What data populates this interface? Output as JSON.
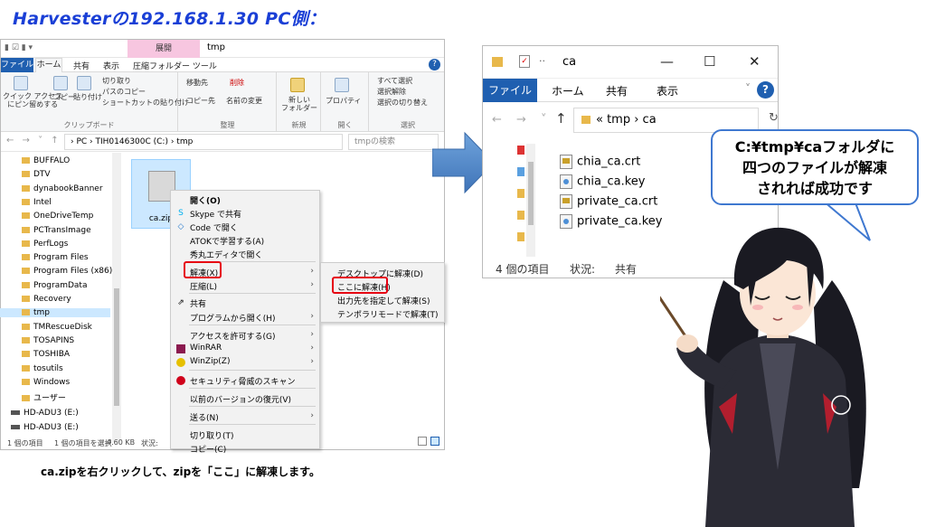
{
  "banner": "Harvesterの192.168.1.30 PC側：",
  "left_window": {
    "title": "tmp",
    "context_tab": "展開",
    "tabs": [
      "ファイル",
      "ホーム",
      "共有",
      "表示",
      "圧縮フォルダー ツール"
    ],
    "ribbon": {
      "pin": "クイック アクセス\nにピン留めする",
      "copy": "コピー",
      "paste": "貼り付け",
      "cut": "切り取り",
      "copy_path": "パスのコピー",
      "paste_shortcut": "ショートカットの貼り付け",
      "clipboard_group": "クリップボード",
      "move_to": "移動先",
      "copy_to": "コピー先",
      "delete": "削除",
      "rename": "名前の変更",
      "organize_group": "整理",
      "new_folder": "新しい\nフォルダー",
      "new_group": "新規",
      "properties": "プロパティ",
      "open_group": "開く",
      "select_all": "すべて選択",
      "select_none": "選択解除",
      "invert_selection": "選択の切り替え",
      "select_group": "選択"
    },
    "address": "›  PC  ›  TIH0146300C (C:)  ›  tmp",
    "search_placeholder": "tmpの検索",
    "tree": [
      "BUFFALO",
      "DTV",
      "dynabookBanner",
      "Intel",
      "OneDriveTemp",
      "PCTransImage",
      "PerfLogs",
      "Program Files",
      "Program Files (x86)",
      "ProgramData",
      "Recovery",
      "tmp",
      "TMRescueDisk",
      "TOSAPINS",
      "TOSHIBA",
      "tosutils",
      "Windows",
      "ユーザー"
    ],
    "drives": [
      "HD-ADU3 (E:)",
      "HD-ADU3 (E:)"
    ],
    "file_name": "ca.zip",
    "status": {
      "count": "1 個の項目",
      "selected": "1 個の項目を選択",
      "size": "4.60 KB",
      "state": "状況:"
    }
  },
  "context_menu": [
    "開く(O)",
    "Skype で共有",
    "Code で開く",
    "ATOKで学習する(A)",
    "秀丸エディタで開く",
    "解凍(X)",
    "圧縮(L)",
    "共有",
    "プログラムから開く(H)",
    "アクセスを許可する(G)",
    "WinRAR",
    "WinZip(Z)",
    "セキュリティ脅威のスキャン",
    "以前のバージョンの復元(V)",
    "送る(N)",
    "切り取り(T)",
    "コピー(C)"
  ],
  "submenu": [
    "デスクトップに解凍(D)",
    "ここに解凍(H)",
    "出力先を指定して解凍(S)",
    "テンポラリモードで解凍(T)"
  ],
  "caption_left": "ca.zipを右クリックして、zipを「ここ」に解凍します。",
  "right_window": {
    "title": "ca",
    "tabs": [
      "ファイル",
      "ホーム",
      "共有",
      "表示"
    ],
    "address": "«  tmp  ›  ca",
    "files": [
      {
        "name": "chia_ca.crt",
        "icon": "certificate-icon"
      },
      {
        "name": "chia_ca.key",
        "icon": "key-file-icon"
      },
      {
        "name": "private_ca.crt",
        "icon": "certificate-icon"
      },
      {
        "name": "private_ca.key",
        "icon": "key-file-icon"
      }
    ],
    "status_count": "4 個の項目",
    "status_state": "状況:",
    "status_share": "共有"
  },
  "bubble": [
    "C:¥tmp¥caフォルダに",
    "四つのファイルが解凍",
    "されれば成功です"
  ],
  "colors": {
    "banner": "#1a3fd6",
    "file_tab": "#1f5fb0",
    "highlight_box": "#e60012",
    "selection": "#cce8ff",
    "bubble_border": "#3f78d0",
    "arrow": "#4a86c8"
  }
}
